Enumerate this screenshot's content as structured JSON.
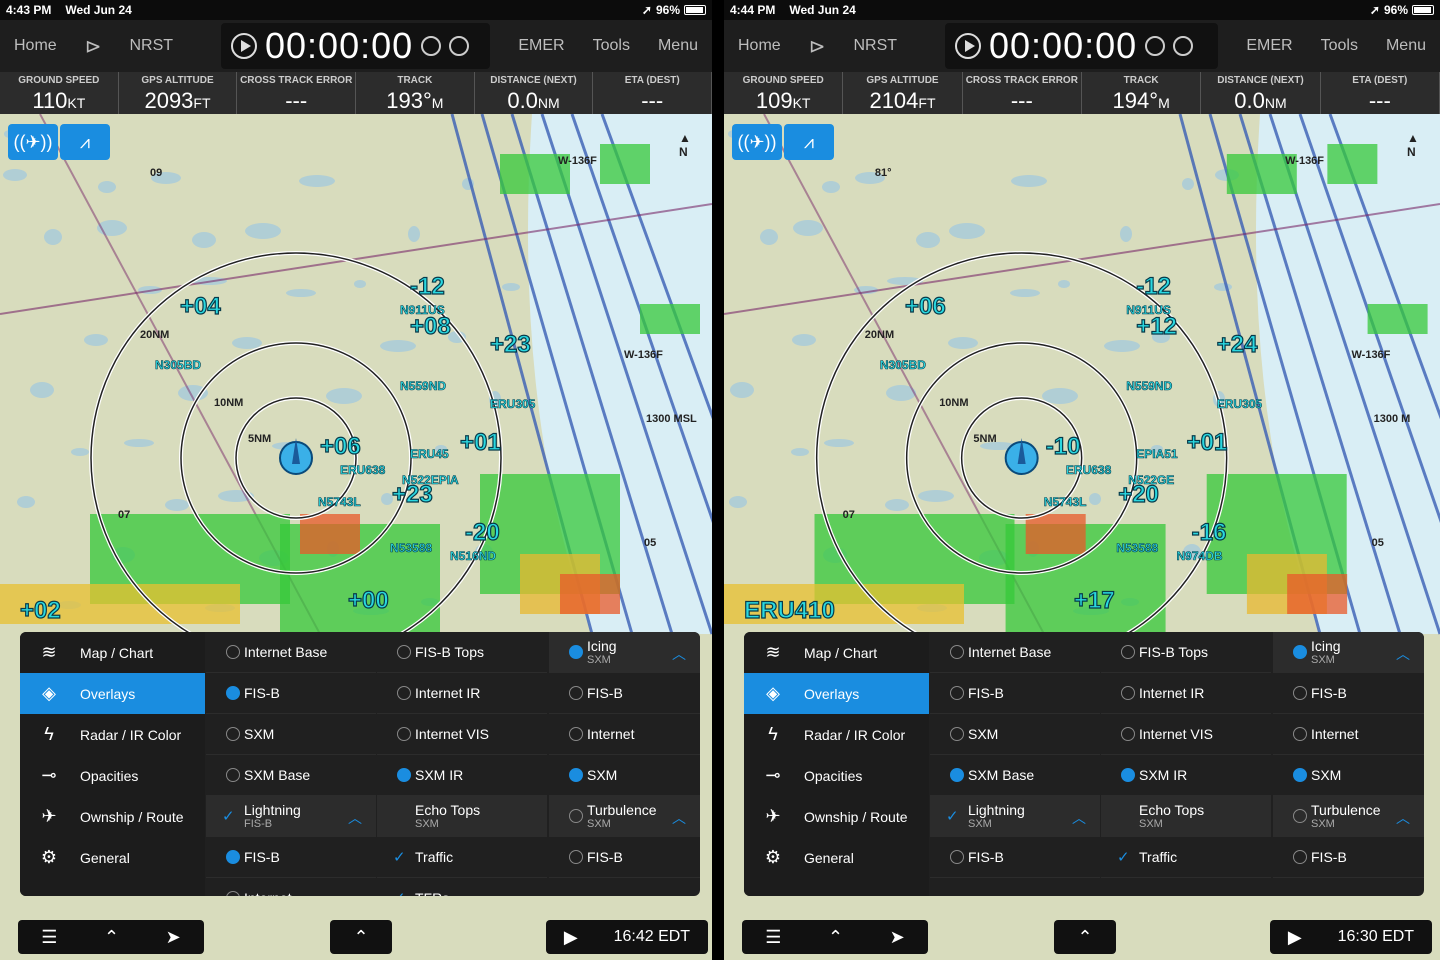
{
  "left": {
    "status": {
      "time": "4:43 PM",
      "date": "Wed Jun 24",
      "battery": "96%"
    },
    "nav": {
      "home": "Home",
      "nrst": "NRST",
      "timer": "00:00:00",
      "emer": "EMER",
      "tools": "Tools",
      "menu": "Menu"
    },
    "instruments": [
      {
        "label": "GROUND SPEED",
        "value": "110",
        "unit": "KT"
      },
      {
        "label": "GPS ALTITUDE",
        "value": "2093",
        "unit": "FT"
      },
      {
        "label": "CROSS TRACK ERROR",
        "value": "---",
        "unit": ""
      },
      {
        "label": "TRACK",
        "value": "193°",
        "unit": "M"
      },
      {
        "label": "DISTANCE (NEXT)",
        "value": "0.0",
        "unit": "NM"
      },
      {
        "label": "ETA (DEST)",
        "value": "---",
        "unit": ""
      }
    ],
    "map_labels": {
      "t1": "+04",
      "t2": "N305BD",
      "t3": "-12",
      "t4": "N911US",
      "t5": "+08",
      "t6": "+23",
      "t7": "ERU305",
      "t8": "N559ND",
      "t9": "+06",
      "t10": "ERU638",
      "t11": "N5743L",
      "t12": "+23",
      "t13": "N522EPIA",
      "t14": "-20",
      "t15": "N53588",
      "t16": "N516ND",
      "t17": "+00",
      "t18": "+02",
      "t19": "+01",
      "t20": "ERU45",
      "ring1": "5NM",
      "ring2": "10NM",
      "ring3": "20NM",
      "w136": "W-136F",
      "w136b": "W-136F",
      "msl": "1300 MSL",
      "n07": "07",
      "n05": "05",
      "n09": "09"
    },
    "panel": {
      "categories": [
        "Map / Chart",
        "Overlays",
        "Radar / IR Color",
        "Opacities",
        "Ownship / Route",
        "General"
      ],
      "col1": [
        {
          "label": "Internet Base",
          "state": "off"
        },
        {
          "label": "FIS-B",
          "state": "on"
        },
        {
          "label": "SXM",
          "state": "off"
        },
        {
          "label": "SXM Base",
          "state": "off"
        },
        {
          "label": "Lightning",
          "sub": "FIS-B",
          "state": "group"
        },
        {
          "label": "FIS-B",
          "state": "on"
        },
        {
          "label": "Internet",
          "state": "off"
        }
      ],
      "col2": [
        {
          "label": "FIS-B Tops",
          "state": "off"
        },
        {
          "label": "Internet IR",
          "state": "off"
        },
        {
          "label": "Internet VIS",
          "state": "off"
        },
        {
          "label": "SXM IR",
          "state": "on"
        },
        {
          "label": "Echo Tops",
          "sub": "SXM",
          "state": "group2"
        },
        {
          "label": "Traffic",
          "state": "check"
        },
        {
          "label": "TFRs",
          "state": "check"
        }
      ],
      "col3": [
        {
          "label": "Icing",
          "sub": "SXM",
          "state": "group3"
        },
        {
          "label": "FIS-B",
          "state": "off"
        },
        {
          "label": "Internet",
          "state": "off"
        },
        {
          "label": "SXM",
          "state": "on"
        },
        {
          "label": "Turbulence",
          "sub": "SXM",
          "state": "group4"
        },
        {
          "label": "FIS-B",
          "state": "off"
        }
      ]
    },
    "bottom": {
      "clock": "16:42 EDT"
    }
  },
  "right": {
    "status": {
      "time": "4:44 PM",
      "date": "Wed Jun 24",
      "battery": "96%"
    },
    "nav": {
      "home": "Home",
      "nrst": "NRST",
      "timer": "00:00:00",
      "emer": "EMER",
      "tools": "Tools",
      "menu": "Menu"
    },
    "instruments": [
      {
        "label": "GROUND SPEED",
        "value": "109",
        "unit": "KT"
      },
      {
        "label": "GPS ALTITUDE",
        "value": "2104",
        "unit": "FT"
      },
      {
        "label": "CROSS TRACK ERROR",
        "value": "---",
        "unit": ""
      },
      {
        "label": "TRACK",
        "value": "194°",
        "unit": "M"
      },
      {
        "label": "DISTANCE (NEXT)",
        "value": "0.0",
        "unit": "NM"
      },
      {
        "label": "ETA (DEST)",
        "value": "---",
        "unit": ""
      }
    ],
    "map_labels": {
      "t1": "+06",
      "t2": "N305BD",
      "t3": "-12",
      "t4": "N911US",
      "t5": "+12",
      "t6": "+24",
      "t7": "ERU305",
      "t8": "N559ND",
      "t9": "-10",
      "t10": "ERU638",
      "t11": "N5743L",
      "t12": "+20",
      "t13": "N522GE",
      "t14": "-16",
      "t15": "N53588",
      "t16": "N974DB",
      "t17": "+17",
      "t18": "ERU410",
      "t19": "+01",
      "t20": "EPIA51",
      "ring1": "5NM",
      "ring2": "10NM",
      "ring3": "20NM",
      "w136": "W-136F",
      "w136b": "W-136F",
      "msl": "1300 M",
      "n07": "07",
      "n05": "05",
      "n09": "81°"
    },
    "panel": {
      "categories": [
        "Map / Chart",
        "Overlays",
        "Radar / IR Color",
        "Opacities",
        "Ownship / Route",
        "General"
      ],
      "col1": [
        {
          "label": "Internet Base",
          "state": "off"
        },
        {
          "label": "FIS-B",
          "state": "off"
        },
        {
          "label": "SXM",
          "state": "off"
        },
        {
          "label": "SXM Base",
          "state": "on"
        },
        {
          "label": "Lightning",
          "sub": "SXM",
          "state": "group"
        },
        {
          "label": "FIS-B",
          "state": "off"
        }
      ],
      "col2": [
        {
          "label": "FIS-B Tops",
          "state": "off"
        },
        {
          "label": "Internet IR",
          "state": "off"
        },
        {
          "label": "Internet VIS",
          "state": "off"
        },
        {
          "label": "SXM IR",
          "state": "on"
        },
        {
          "label": "Echo Tops",
          "sub": "SXM",
          "state": "group2"
        },
        {
          "label": "Traffic",
          "state": "check"
        }
      ],
      "col3": [
        {
          "label": "Icing",
          "sub": "SXM",
          "state": "group3"
        },
        {
          "label": "FIS-B",
          "state": "off"
        },
        {
          "label": "Internet",
          "state": "off"
        },
        {
          "label": "SXM",
          "state": "on"
        },
        {
          "label": "Turbulence",
          "sub": "SXM",
          "state": "group4"
        },
        {
          "label": "FIS-B",
          "state": "off"
        }
      ]
    },
    "bottom": {
      "clock": "16:30 EDT"
    }
  }
}
